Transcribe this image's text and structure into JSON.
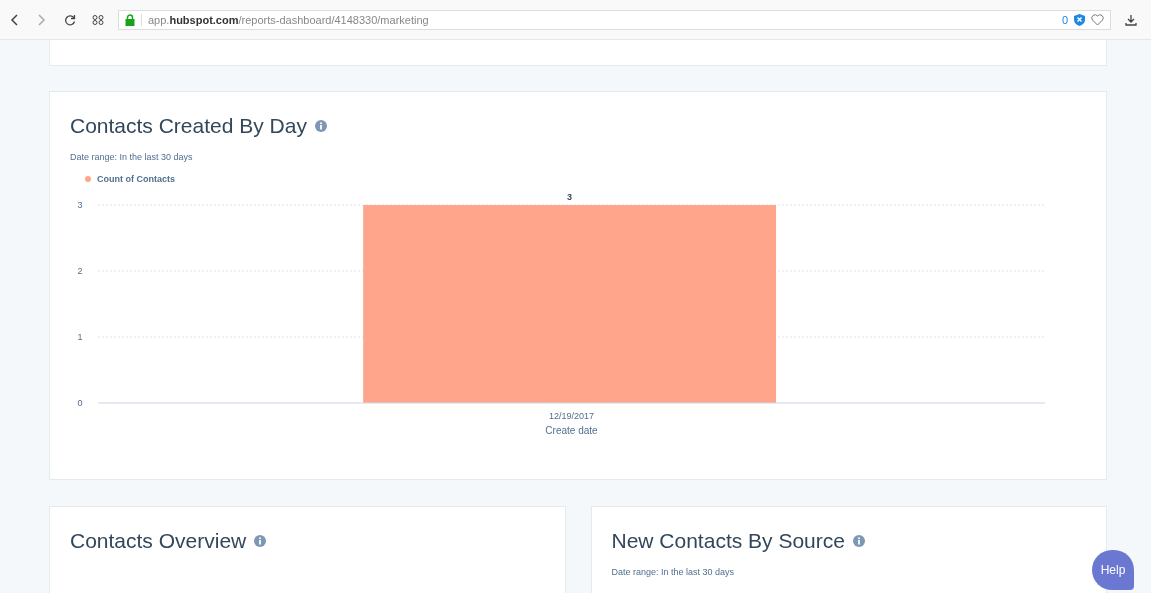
{
  "browser": {
    "url": "app.**hubspot.com**/reports-dashboard/4148330/marketing",
    "tracker_count": "0"
  },
  "report": {
    "title": "Contacts Created By Day",
    "date_range": "Date range: In the last 30 days",
    "chart_data": {
      "type": "bar",
      "xlabel": "Create date",
      "categories": [
        "12/19/2017"
      ],
      "series": [
        {
          "name": "Count of Contacts",
          "color": "#ffa58c",
          "values": [
            3
          ]
        }
      ],
      "ylim": [
        0,
        3
      ],
      "yticks": [
        0,
        1,
        2,
        3
      ],
      "data_labels": true
    }
  },
  "cards": [
    {
      "title": "Contacts Overview"
    },
    {
      "title": "New Contacts By Source",
      "date_range": "Date range: In the last 30 days"
    }
  ],
  "help_button": "Help"
}
